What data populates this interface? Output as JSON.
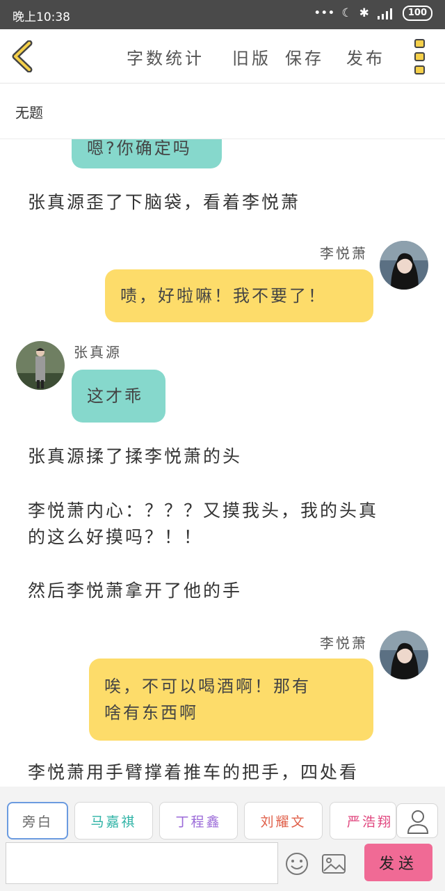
{
  "status_bar": {
    "time": "晚上10:38",
    "battery": "100"
  },
  "toolbar": {
    "word_count": "字数统计",
    "old_version": "旧版",
    "save": "保存",
    "publish": "发布"
  },
  "doc_title": "无题",
  "chat": {
    "m0_text": "嗯?你确定吗",
    "n1": "张真源歪了下脑袋，看着李悦萧",
    "m2_name": "李悦萧",
    "m2_text": "啧，好啦嘛！我不要了！",
    "m3_name": "张真源",
    "m3_text": "这才乖",
    "n4": "张真源揉了揉李悦萧的头",
    "n5_line1": "李悦萧内心：？？？又摸我头，我的头真",
    "n5_line2": "的这么好摸吗？！！",
    "n6": "然后李悦萧拿开了他的手",
    "m7_name": "李悦萧",
    "m7_line1": "唉，不可以喝酒啊！那有",
    "m7_line2": "啥有东西啊",
    "n8": "李悦萧用手臂撑着推车的把手，四处看"
  },
  "roles": [
    {
      "label": "旁白",
      "color": "#666666"
    },
    {
      "label": "马嘉祺",
      "color": "#2fb3a6"
    },
    {
      "label": "丁程鑫",
      "color": "#9b6ad8"
    },
    {
      "label": "刘耀文",
      "color": "#e0604a"
    },
    {
      "label": "严浩翔",
      "color": "#e0467e"
    }
  ],
  "input": {
    "placeholder": ""
  },
  "send_label": "发送",
  "icons": [
    "back-icon",
    "more-icon",
    "person-icon",
    "emoji-icon",
    "image-icon"
  ],
  "colors": {
    "accent_yellow": "#fddc6a",
    "accent_teal": "#86d8cc",
    "send_pink": "#f06a95"
  }
}
